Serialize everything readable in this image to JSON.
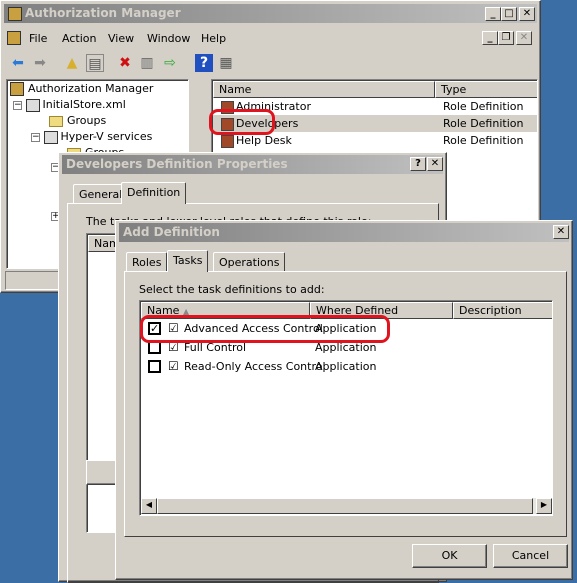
{
  "main_window": {
    "title": "Authorization Manager",
    "menu": [
      "File",
      "Action",
      "View",
      "Window",
      "Help"
    ],
    "toolbar_icons": [
      "back-icon",
      "forward-icon",
      "up-folder-icon",
      "show-hide-tree-icon",
      "delete-icon",
      "properties-icon",
      "export-icon",
      "help-icon",
      "console-icon"
    ],
    "tree": {
      "root": "Authorization Manager",
      "store": "InitialStore.xml",
      "groups": "Groups",
      "app": "Hyper-V services",
      "app_groups": "Groups"
    },
    "list": {
      "columns": [
        "Name",
        "Type"
      ],
      "rows": [
        {
          "name": "Administrator",
          "type": "Role Definition"
        },
        {
          "name": "Developers",
          "type": "Role Definition",
          "selected": true
        },
        {
          "name": "Help Desk",
          "type": "Role Definition"
        }
      ]
    }
  },
  "properties_dialog": {
    "title": "Developers Definition Properties",
    "tabs": [
      "General",
      "Definition"
    ],
    "active_tab": "Definition",
    "description": "The tasks and lower-level roles that define this role:",
    "list_header": "Name"
  },
  "add_definition": {
    "title": "Add Definition",
    "tabs": [
      "Roles",
      "Tasks",
      "Operations"
    ],
    "active_tab": "Tasks",
    "prompt": "Select the task definitions to add:",
    "columns": [
      "Name",
      "Where Defined",
      "Description"
    ],
    "rows": [
      {
        "name": "Advanced Access Control",
        "where": "Application",
        "checked": true
      },
      {
        "name": "Full Control",
        "where": "Application",
        "checked": false
      },
      {
        "name": "Read-Only Access Control",
        "where": "Application",
        "checked": false
      }
    ],
    "ok": "OK",
    "cancel": "Cancel"
  },
  "highlight_color": "#e0141e"
}
